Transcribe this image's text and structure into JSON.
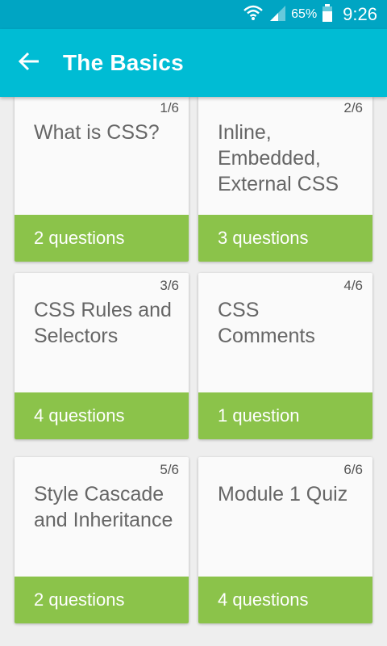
{
  "status_bar": {
    "battery_percent": "65%",
    "time": "9:26",
    "icons": [
      "wifi-icon",
      "signal-icon",
      "battery-icon"
    ]
  },
  "app_bar": {
    "title": "The Basics",
    "back_icon": "arrow-left-icon"
  },
  "colors": {
    "status_bar": "#00a5c3",
    "app_bar": "#00bcd4",
    "card_footer": "#8bc34a",
    "background": "#eeeeee"
  },
  "lessons": [
    {
      "progress": "1/6",
      "title": "What is CSS?",
      "questions": "2 questions"
    },
    {
      "progress": "2/6",
      "title": "Inline, Embedded, External CSS",
      "questions": "3 questions"
    },
    {
      "progress": "3/6",
      "title": "CSS Rules and Selectors",
      "questions": "4 questions"
    },
    {
      "progress": "4/6",
      "title": "CSS Comments",
      "questions": "1 question"
    },
    {
      "progress": "5/6",
      "title": "Style Cascade and Inheritance",
      "questions": "2 questions"
    },
    {
      "progress": "6/6",
      "title": "Module 1 Quiz",
      "questions": "4 questions"
    }
  ]
}
